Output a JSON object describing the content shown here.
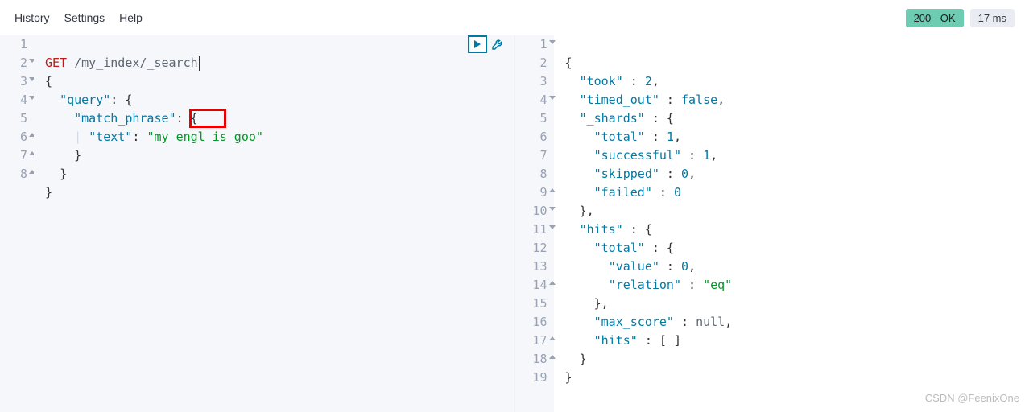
{
  "menu": {
    "history": "History",
    "settings": "Settings",
    "help": "Help"
  },
  "status": {
    "code_label": "200 - OK",
    "time_label": "17 ms"
  },
  "request": {
    "method": "GET",
    "path": "/my_index/_search",
    "lines": [
      "1",
      "2",
      "3",
      "4",
      "5",
      "6",
      "7",
      "8"
    ],
    "body_keys": {
      "query": "\"query\"",
      "match_phrase": "\"match_phrase\"",
      "text": "\"text\""
    },
    "body_vals": {
      "pre": "\"my ",
      "boxed": "engl",
      "post": " is goo\""
    }
  },
  "response": {
    "lines": [
      "1",
      "2",
      "3",
      "4",
      "5",
      "6",
      "7",
      "8",
      "9",
      "10",
      "11",
      "12",
      "13",
      "14",
      "15",
      "16",
      "17",
      "18",
      "19"
    ],
    "keys": {
      "took": "\"took\"",
      "timed_out": "\"timed_out\"",
      "shards": "\"_shards\"",
      "total": "\"total\"",
      "successful": "\"successful\"",
      "skipped": "\"skipped\"",
      "failed": "\"failed\"",
      "hits": "\"hits\"",
      "value": "\"value\"",
      "relation": "\"relation\"",
      "max_score": "\"max_score\""
    },
    "vals": {
      "took": "2",
      "timed_out": "false",
      "shards_total": "1",
      "shards_successful": "1",
      "shards_skipped": "0",
      "shards_failed": "0",
      "hits_total_value": "0",
      "hits_total_relation": "\"eq\"",
      "max_score": "null",
      "hits_arr": "[ ]"
    }
  },
  "watermark": "CSDN @FeenixOne"
}
